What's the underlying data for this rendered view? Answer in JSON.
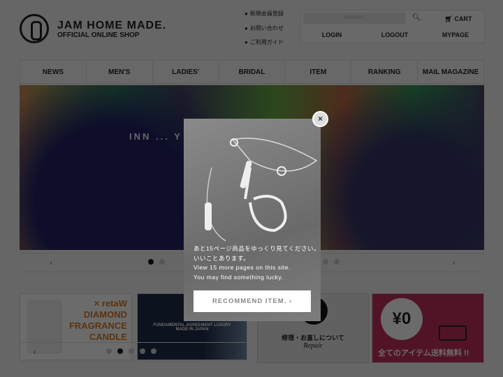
{
  "header": {
    "brand": "JAM HOME MADE.",
    "tagline": "OFFICIAL ONLINE SHOP",
    "util_links": [
      "新規会員登録",
      "お問い合わせ",
      "ご利用ガイド"
    ],
    "search_placeholder": "SEARCH",
    "cart": "CART",
    "login": "LOGIN",
    "logout": "LOGOUT",
    "mypage": "MYPAGE"
  },
  "nav": [
    "NEWS",
    "MEN'S",
    "LADIES'",
    "BRIDAL",
    "ITEM",
    "RANKING",
    "MAIL MAGAZINE"
  ],
  "hero": {
    "overlay_text": "INN ... Y",
    "prev": "‹",
    "next": "›",
    "slides": 6,
    "active_slide": 1
  },
  "banners": {
    "candle": {
      "line1": "× retaW",
      "line2": "DIAMOND",
      "line3": "FRAGRANCE",
      "line4": "CANDLE"
    },
    "denim": {
      "line1": "FUNDAMENTAL AGREEMENT LUXURY",
      "line2": "MADE IN JAPAN"
    },
    "prev": "‹",
    "next": "›",
    "slides": 5,
    "active_slide": 2,
    "repair": {
      "jp": "修理・お直しについて",
      "en": "Repair"
    },
    "shipping": {
      "price": "¥0",
      "text": "全てのアイテム送料無料 !!",
      "color": "#c0305a"
    }
  },
  "modal": {
    "jp1": "あと15ページ商品をゆっくり見てください。",
    "jp2": "いいことあります。",
    "en1": "View 15 more pages on this site.",
    "en2": "You may find something lucky.",
    "button": "RECOMMEND ITEM.",
    "button_arrow": "›",
    "close": "×",
    "image_number": "15"
  }
}
